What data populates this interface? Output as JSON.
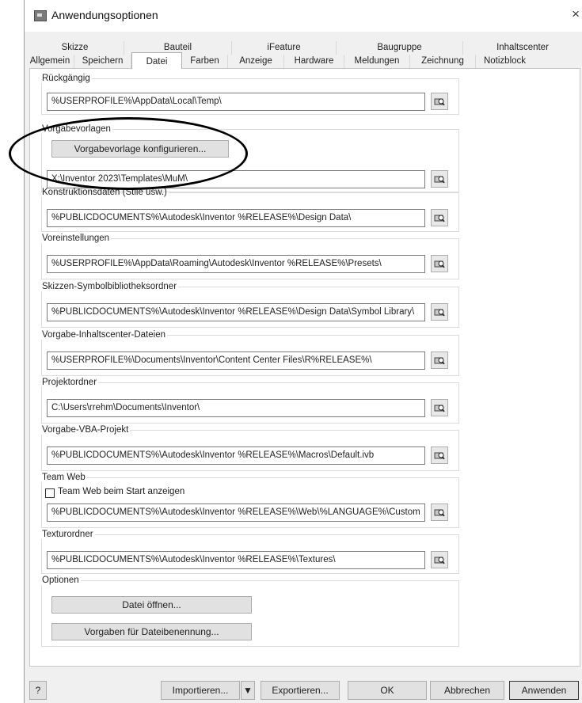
{
  "window": {
    "title": "Anwendungsoptionen",
    "close": "×"
  },
  "tabs_row1": [
    "Skizze",
    "Bauteil",
    "iFeature",
    "Baugruppe",
    "Inhaltscenter"
  ],
  "tabs_row2": [
    "Allgemein",
    "Speichern",
    "Datei",
    "Farben",
    "Anzeige",
    "Hardware",
    "Meldungen",
    "Zeichnung",
    "Notizblock"
  ],
  "active_tab": "Datei",
  "sections": {
    "rueckgaengig": {
      "label": "Rückgängig",
      "path": "%USERPROFILE%\\AppData\\Local\\Temp\\"
    },
    "vorgabevorlagen": {
      "label": "Vorgabevorlagen",
      "button": "Vorgabevorlage konfigurieren...",
      "path": "X:\\Inventor 2023\\Templates\\MuM\\"
    },
    "konstruktionsdaten": {
      "label": "Konstruktionsdaten (Stile usw.)",
      "path": "%PUBLICDOCUMENTS%\\Autodesk\\Inventor %RELEASE%\\Design Data\\"
    },
    "voreinstellungen": {
      "label": "Voreinstellungen",
      "path": "%USERPROFILE%\\AppData\\Roaming\\Autodesk\\Inventor %RELEASE%\\Presets\\"
    },
    "skizzen_symbol": {
      "label": "Skizzen-Symbolbibliotheksordner",
      "path": "%PUBLICDOCUMENTS%\\Autodesk\\Inventor %RELEASE%\\Design Data\\Symbol Library\\"
    },
    "inhaltscenter": {
      "label": "Vorgabe-Inhaltscenter-Dateien",
      "path": "%USERPROFILE%\\Documents\\Inventor\\Content Center Files\\R%RELEASE%\\"
    },
    "projektordner": {
      "label": "Projektordner",
      "path": "C:\\Users\\rrehm\\Documents\\Inventor\\"
    },
    "vba": {
      "label": "Vorgabe-VBA-Projekt",
      "path": "%PUBLICDOCUMENTS%\\Autodesk\\Inventor %RELEASE%\\Macros\\Default.ivb"
    },
    "teamweb": {
      "label": "Team Web",
      "checkbox": "Team Web beim Start anzeigen",
      "checked": false,
      "path": "%PUBLICDOCUMENTS%\\Autodesk\\Inventor %RELEASE%\\Web\\%LANGUAGE%\\Custom"
    },
    "texturordner": {
      "label": "Texturordner",
      "path": "%PUBLICDOCUMENTS%\\Autodesk\\Inventor %RELEASE%\\Textures\\"
    },
    "optionen": {
      "label": "Optionen",
      "btn_open": "Datei öffnen...",
      "btn_naming": "Vorgaben für Dateibenennung..."
    }
  },
  "footer": {
    "help": "?",
    "import": "Importieren...",
    "export": "Exportieren...",
    "ok": "OK",
    "cancel": "Abbrechen",
    "apply": "Anwenden"
  }
}
